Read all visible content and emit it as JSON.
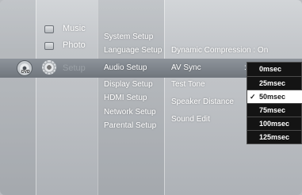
{
  "categories": [
    {
      "label": "Music",
      "icon": "music-icon",
      "active": false
    },
    {
      "label": "Photo",
      "icon": "photo-icon",
      "active": false
    },
    {
      "label": "Setup",
      "icon": "gear-icon",
      "active": true
    }
  ],
  "disc": {
    "label": "DVD",
    "icon": "disc-icon"
  },
  "setup_menu": [
    {
      "label": "System Setup",
      "active": false
    },
    {
      "label": "Language Setup",
      "active": false
    },
    {
      "label": "Audio Setup",
      "active": true
    },
    {
      "label": "Display Setup",
      "active": false
    },
    {
      "label": "HDMI Setup",
      "active": false
    },
    {
      "label": "Network Setup",
      "active": false
    },
    {
      "label": "Parental Setup",
      "active": false
    }
  ],
  "audio_menu": {
    "dynamic_compression": "Dynamic Compression : On",
    "items": [
      {
        "label": "AV Sync",
        "active": true
      },
      {
        "label": "Test Tone",
        "active": false
      },
      {
        "label": "Speaker Distance",
        "active": false
      },
      {
        "label": "Sound Edit",
        "active": false
      }
    ],
    "colon": ":"
  },
  "av_sync_options": {
    "options": [
      "0msec",
      "25msec",
      "50msec",
      "75msec",
      "100msec",
      "125msec"
    ],
    "selected": "50msec",
    "check_mark": "✓"
  },
  "colors": {
    "highlight_band": "#7a8087",
    "dropdown_bg": "#141414",
    "selected_bg": "#ffffff",
    "text": "#ffffff"
  }
}
